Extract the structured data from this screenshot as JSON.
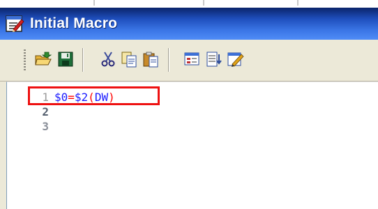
{
  "window": {
    "title": "Initial Macro",
    "title_icon": "macro-edit-icon"
  },
  "toolbar": {
    "buttons": [
      {
        "name": "open",
        "icon": "open-folder-icon"
      },
      {
        "name": "save",
        "icon": "floppy-disk-icon"
      },
      {
        "name": "cut",
        "icon": "scissors-icon"
      },
      {
        "name": "copy",
        "icon": "copy-icon"
      },
      {
        "name": "paste",
        "icon": "paste-icon"
      },
      {
        "name": "command-list",
        "icon": "command-list-icon"
      },
      {
        "name": "insert-line",
        "icon": "insert-line-icon"
      },
      {
        "name": "check",
        "icon": "edit-check-icon"
      }
    ]
  },
  "editor": {
    "lines": [
      {
        "number": "1",
        "tokens": [
          "$0",
          "=",
          "$2",
          "(",
          "DW",
          ")"
        ]
      },
      {
        "number": "2",
        "tokens": []
      },
      {
        "number": "3",
        "tokens": []
      }
    ]
  },
  "colors": {
    "variable": "#1a1aff",
    "operator": "#ff0000",
    "highlight_box": "#ee1111",
    "titlebar_top": "#0a246a",
    "titlebar_bottom": "#4f8cf7"
  }
}
